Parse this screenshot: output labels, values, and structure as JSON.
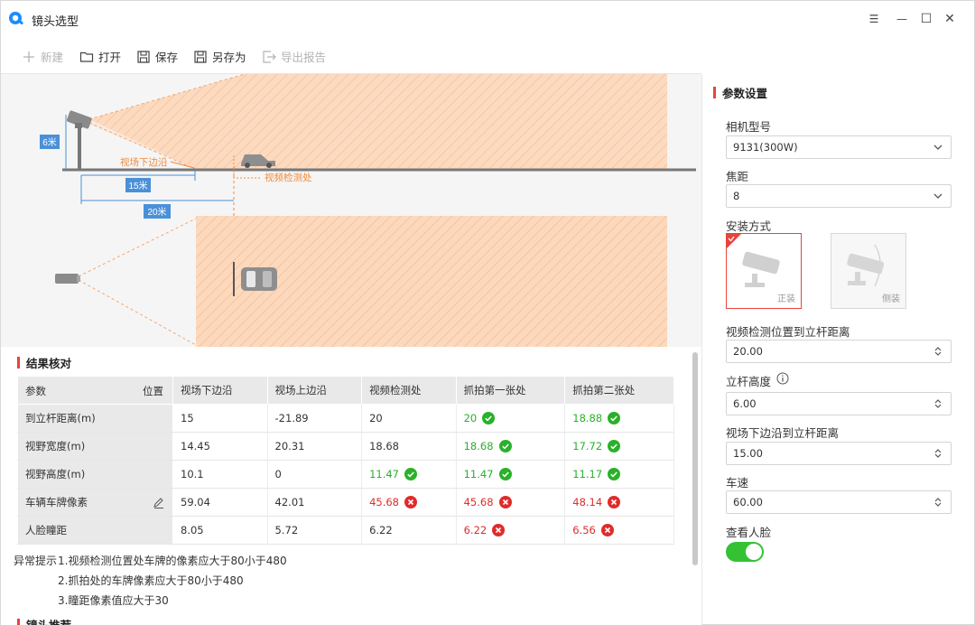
{
  "window": {
    "title": "镜头选型",
    "controls": {
      "menu": "☰",
      "minimize": "—",
      "maximize": "☐",
      "close": "✕"
    }
  },
  "toolbar": {
    "new_label": "新建",
    "open_label": "打开",
    "save_label": "保存",
    "save_as_label": "另存为",
    "export_label": "导出报告"
  },
  "diagram": {
    "height_tag": "6米",
    "fov_lower_edge": "视场下边沿",
    "detection_point": "视频检测处",
    "dist_15": "15米",
    "dist_20": "20米",
    "fov_color": "#fbd4b6"
  },
  "results": {
    "title": "结果核对",
    "corner_param": "参数",
    "corner_position": "位置",
    "columns": [
      "视场下边沿",
      "视场上边沿",
      "视频检测处",
      "抓拍第一张处",
      "抓拍第二张处"
    ],
    "rows": [
      {
        "label": "到立杆距离(m)",
        "cells": [
          {
            "v": "15",
            "s": ""
          },
          {
            "v": "-21.89",
            "s": ""
          },
          {
            "v": "20",
            "s": ""
          },
          {
            "v": "20",
            "s": "ok"
          },
          {
            "v": "18.88",
            "s": "ok"
          }
        ]
      },
      {
        "label": "视野宽度(m)",
        "cells": [
          {
            "v": "14.45",
            "s": ""
          },
          {
            "v": "20.31",
            "s": ""
          },
          {
            "v": "18.68",
            "s": ""
          },
          {
            "v": "18.68",
            "s": "ok"
          },
          {
            "v": "17.72",
            "s": "ok"
          }
        ]
      },
      {
        "label": "视野高度(m)",
        "cells": [
          {
            "v": "10.1",
            "s": ""
          },
          {
            "v": "0",
            "s": ""
          },
          {
            "v": "11.47",
            "s": "ok"
          },
          {
            "v": "11.47",
            "s": "ok"
          },
          {
            "v": "11.17",
            "s": "ok"
          }
        ]
      },
      {
        "label": "车辆车牌像素",
        "edit": true,
        "cells": [
          {
            "v": "59.04",
            "s": ""
          },
          {
            "v": "42.01",
            "s": ""
          },
          {
            "v": "45.68",
            "s": "bad"
          },
          {
            "v": "45.68",
            "s": "bad"
          },
          {
            "v": "48.14",
            "s": "bad"
          }
        ]
      },
      {
        "label": "人脸瞳距",
        "cells": [
          {
            "v": "8.05",
            "s": ""
          },
          {
            "v": "5.72",
            "s": ""
          },
          {
            "v": "6.22",
            "s": ""
          },
          {
            "v": "6.22",
            "s": "bad"
          },
          {
            "v": "6.56",
            "s": "bad"
          }
        ]
      }
    ],
    "warning_label": "异常提示",
    "warnings": [
      "1.视频检测位置处车牌的像素应大于80小于480",
      "2.抓拍处的车牌像素应大于80小于480",
      "3.瞳距像素值应大于30"
    ],
    "next_section_peek": "镜头推荐"
  },
  "settings": {
    "title": "参数设置",
    "camera_model_label": "相机型号",
    "camera_model_value": "9131(300W)",
    "focal_label": "焦距",
    "focal_value": "8",
    "mount_label": "安装方式",
    "mount_front": "正装",
    "mount_side": "侧装",
    "detect_dist_label": "视频检测位置到立杆距离",
    "detect_dist_value": "20.00",
    "pole_height_label": "立杆高度",
    "pole_height_value": "6.00",
    "fov_lower_label": "视场下边沿到立杆距离",
    "fov_lower_value": "15.00",
    "speed_label": "车速",
    "speed_value": "60.00",
    "view_face_label": "查看人脸",
    "view_face_on": true
  },
  "colors": {
    "accent": "#e8433c",
    "ok": "#29b129",
    "bad": "#e02b2b",
    "toggle": "#34c234",
    "dim_label": "#4a90d9"
  }
}
